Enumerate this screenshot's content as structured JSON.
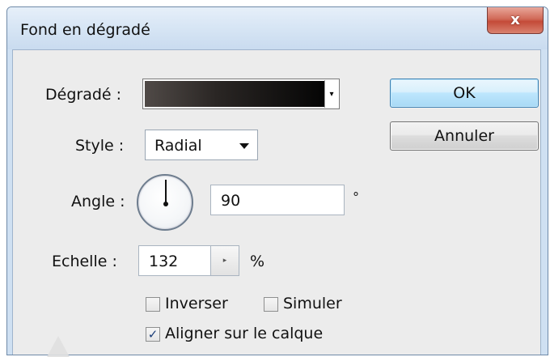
{
  "window": {
    "title": "Fond en dégradé",
    "close_symbol": "x"
  },
  "gradient": {
    "label": "Dégradé :",
    "arrow": "▾",
    "colors": [
      "#504a47",
      "#050505"
    ]
  },
  "style": {
    "label": "Style :",
    "value": "Radial"
  },
  "angle": {
    "label": "Angle :",
    "value": "90",
    "unit": "°"
  },
  "scale": {
    "label": "Echelle :",
    "value": "132",
    "stepper_symbol": "▸",
    "unit": "%"
  },
  "options": {
    "invert": {
      "label": "Inverser",
      "checked": false
    },
    "dither": {
      "label": "Simuler",
      "checked": false
    },
    "align": {
      "label": "Aligner sur le calque",
      "checked": true,
      "check_symbol": "✓"
    }
  },
  "buttons": {
    "ok": "OK",
    "cancel": "Annuler"
  },
  "colors": {
    "ok_border": "#3c7fb1",
    "close_red": "#c44a38",
    "client_bg": "#ececec",
    "frame_blue": "#cfe0f2"
  }
}
